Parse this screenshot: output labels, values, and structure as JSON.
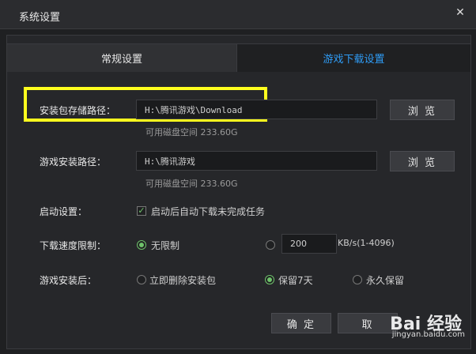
{
  "window": {
    "title": "系统设置",
    "close_icon": "close-icon"
  },
  "tabs": [
    {
      "label": "常规设置",
      "active": false
    },
    {
      "label": "游戏下载设置",
      "active": true
    }
  ],
  "settings": {
    "package_path": {
      "label": "安装包存储路径：",
      "value": "H:\\腾讯游戏\\Download",
      "disk_space": "可用磁盘空间 233.60G",
      "browse_label": "浏 览"
    },
    "install_path": {
      "label": "游戏安装路径：",
      "value": "H:\\腾讯游戏",
      "disk_space": "可用磁盘空间 233.60G",
      "browse_label": "浏 览"
    },
    "startup": {
      "label": "启动设置：",
      "checkbox_label": "启动后自动下载未完成任务",
      "checked": true
    },
    "speed_limit": {
      "label": "下载速度限制：",
      "unlimited_label": "无限制",
      "limit_value": "200",
      "unit_range": "KB/s(1-4096)",
      "selected": "unlimited"
    },
    "after_install": {
      "label": "游戏安装后：",
      "options": [
        "立即删除安装包",
        "保留7天",
        "永久保留"
      ],
      "selected": "保留7天"
    }
  },
  "actions": {
    "confirm_label": "确 定",
    "cancel_label": "取"
  },
  "watermark": {
    "brand": "Bai 经验",
    "url": "jingyan.baidu.com"
  },
  "colors": {
    "accent_tab": "#2f9bf4",
    "highlight": "#ffff1e",
    "radio_on": "#6fc26b"
  }
}
